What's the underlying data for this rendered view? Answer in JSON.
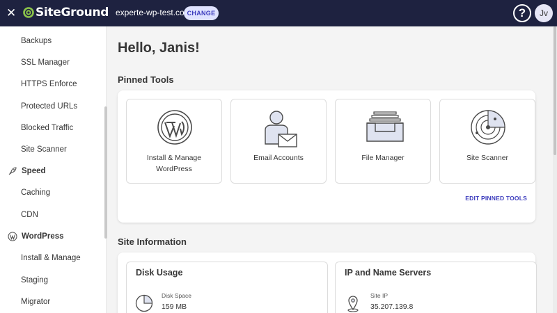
{
  "header": {
    "close_icon": "close-icon",
    "logo_text": "SiteGround",
    "logo_icon": "siteground-swirl-icon",
    "domain": "experte-wp-test.com",
    "change_label": "CHANGE",
    "help_icon": "help-icon",
    "help_glyph": "?",
    "avatar_initials": "Jv",
    "bar_color": "#1e2240",
    "accent_color": "#3c3cbd"
  },
  "sidebar": {
    "items": [
      {
        "label": "Backups"
      },
      {
        "label": "SSL Manager"
      },
      {
        "label": "HTTPS Enforce"
      },
      {
        "label": "Protected URLs"
      },
      {
        "label": "Blocked Traffic"
      },
      {
        "label": "Site Scanner"
      }
    ],
    "speed": {
      "label": "Speed",
      "icon": "rocket-icon",
      "items": [
        {
          "label": "Caching"
        },
        {
          "label": "CDN"
        }
      ]
    },
    "wordpress": {
      "label": "WordPress",
      "icon": "wordpress-icon",
      "items": [
        {
          "label": "Install & Manage"
        },
        {
          "label": "Staging"
        },
        {
          "label": "Migrator"
        }
      ]
    }
  },
  "main": {
    "greeting": "Hello, Janis!",
    "pinned_title": "Pinned Tools",
    "tools": [
      {
        "label_line1": "Install & Manage",
        "label_line2": "WordPress",
        "icon": "wordpress-icon"
      },
      {
        "label_line1": "Email Accounts",
        "label_line2": "",
        "icon": "email-accounts-icon"
      },
      {
        "label_line1": "File Manager",
        "label_line2": "",
        "icon": "file-manager-icon"
      },
      {
        "label_line1": "Site Scanner",
        "label_line2": "",
        "icon": "radar-icon"
      }
    ],
    "edit_pinned_label": "EDIT PINNED TOOLS",
    "site_info_title": "Site Information",
    "disk": {
      "title": "Disk Usage",
      "key": "Disk Space",
      "value": "159 MB",
      "icon": "pie-chart-icon"
    },
    "ip": {
      "title": "IP and Name Servers",
      "key": "Site IP",
      "value": "35.207.139.8",
      "icon": "location-pin-icon"
    }
  }
}
